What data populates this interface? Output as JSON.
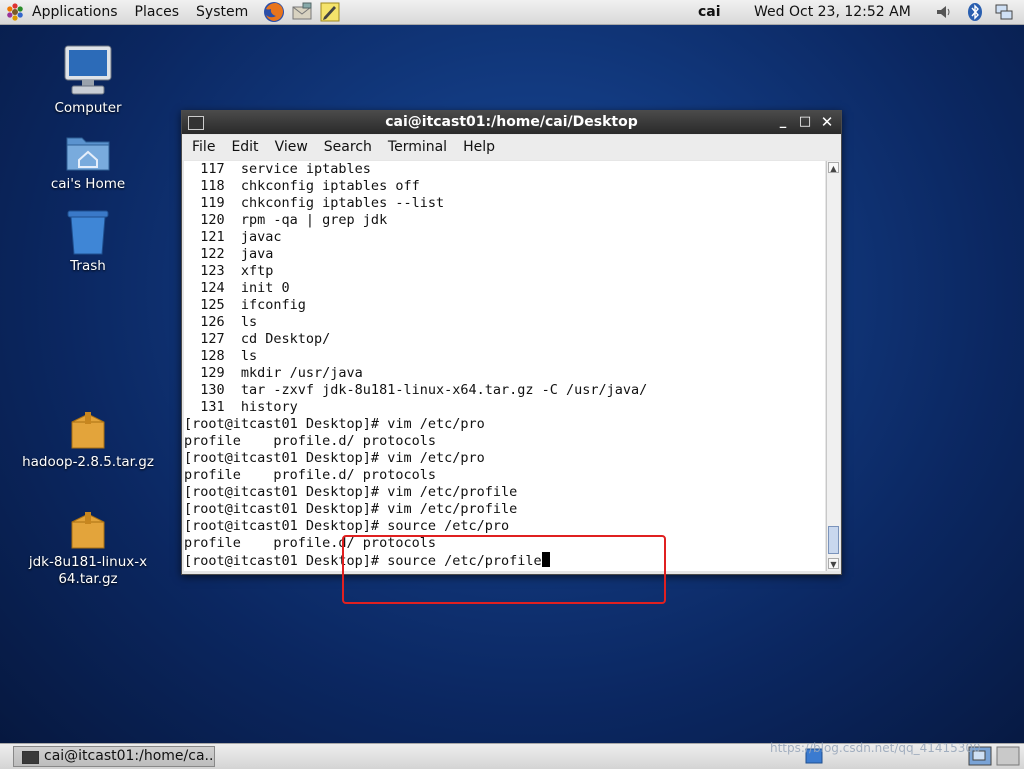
{
  "top_panel": {
    "menus": [
      "Applications",
      "Places",
      "System"
    ],
    "user": "cai",
    "clock": "Wed Oct 23, 12:52 AM"
  },
  "desktop": {
    "icons": [
      {
        "label": "Computer",
        "icon": "computer-icon"
      },
      {
        "label": "cai's Home",
        "icon": "home-folder-icon"
      },
      {
        "label": "Trash",
        "icon": "trash-icon"
      },
      {
        "label": "hadoop-2.8.5.tar.gz",
        "icon": "archive-icon"
      },
      {
        "label": "jdk-8u181-linux-x64.tar.gz",
        "icon": "archive-icon"
      }
    ]
  },
  "terminal": {
    "title": "cai@itcast01:/home/cai/Desktop",
    "menus": [
      "File",
      "Edit",
      "View",
      "Search",
      "Terminal",
      "Help"
    ],
    "lines": [
      "  117  service iptables",
      "  118  chkconfig iptables off",
      "  119  chkconfig iptables --list",
      "  120  rpm -qa | grep jdk",
      "  121  javac",
      "  122  java",
      "  123  xftp",
      "  124  init 0",
      "  125  ifconfig",
      "  126  ls",
      "  127  cd Desktop/",
      "  128  ls",
      "  129  mkdir /usr/java",
      "  130  tar -zxvf jdk-8u181-linux-x64.tar.gz -C /usr/java/",
      "  131  history",
      "[root@itcast01 Desktop]# vim /etc/pro",
      "profile    profile.d/ protocols",
      "[root@itcast01 Desktop]# vim /etc/pro",
      "profile    profile.d/ protocols",
      "[root@itcast01 Desktop]# vim /etc/profile",
      "[root@itcast01 Desktop]# vim /etc/profile",
      "[root@itcast01 Desktop]# source /etc/pro",
      "profile    profile.d/ protocols"
    ],
    "current_line": "[root@itcast01 Desktop]# source /etc/profile"
  },
  "taskbar": {
    "window_button": "cai@itcast01:/home/ca...",
    "watermark": "https://blog.csdn.net/qq_41415300"
  },
  "colors": {
    "annotation": "#e02020",
    "desktop_bg": "#0b2761"
  }
}
